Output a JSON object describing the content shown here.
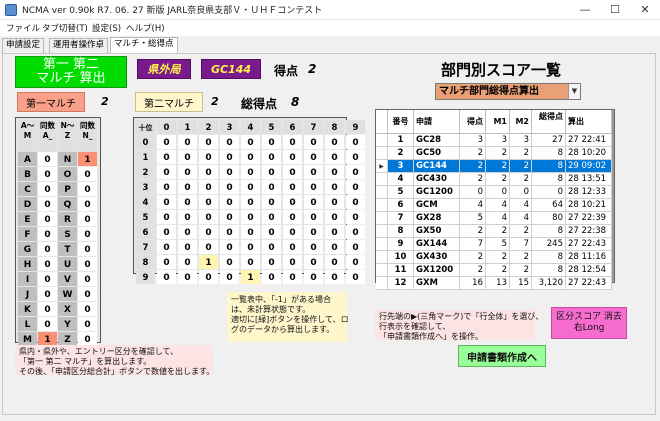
{
  "window": {
    "title": "NCMA ver 0.90k  R7. 06. 27 新版 JARL奈良県支部Ｖ・ＵＨＦコンテスト",
    "minimize": "—",
    "maximize": "☐",
    "close": "✕"
  },
  "menu": [
    "ファイル",
    "タブ切替(T)",
    "設定(S)",
    "ヘルプ(H)"
  ],
  "tabs": [
    "申請設定",
    "運用者操作卓",
    "マルチ・総得点"
  ],
  "calc_button": {
    "line1": "第一 第二",
    "line2": "マルチ 算出"
  },
  "tag_outside": "県外局",
  "tag_call": "GC144",
  "score_label": "得点",
  "score_value": "2",
  "first_multi": {
    "label": "第一マルチ",
    "value": "2"
  },
  "second_multi": {
    "label": "第二マルチ",
    "value": "2"
  },
  "total_label": "総得点",
  "total_value": "8",
  "left_grid": {
    "headers": [
      "A～M",
      "同数A_",
      "N～Z",
      "同数N_"
    ],
    "rows": [
      [
        "A",
        "0",
        "N",
        "1"
      ],
      [
        "B",
        "0",
        "O",
        "0"
      ],
      [
        "C",
        "0",
        "P",
        "0"
      ],
      [
        "D",
        "0",
        "Q",
        "0"
      ],
      [
        "E",
        "0",
        "R",
        "0"
      ],
      [
        "F",
        "0",
        "S",
        "0"
      ],
      [
        "G",
        "0",
        "T",
        "0"
      ],
      [
        "H",
        "0",
        "U",
        "0"
      ],
      [
        "I",
        "0",
        "V",
        "0"
      ],
      [
        "J",
        "0",
        "W",
        "0"
      ],
      [
        "K",
        "0",
        "X",
        "0"
      ],
      [
        "L",
        "0",
        "Y",
        "0"
      ],
      [
        "M",
        "1",
        "Z",
        "0"
      ]
    ]
  },
  "digit_grid": {
    "corner": "十位",
    "cols": [
      "0",
      "1",
      "2",
      "3",
      "4",
      "5",
      "6",
      "7",
      "8",
      "9"
    ],
    "rows": [
      [
        "0",
        "0",
        "0",
        "0",
        "0",
        "0",
        "0",
        "0",
        "0",
        "0"
      ],
      [
        "0",
        "0",
        "0",
        "0",
        "0",
        "0",
        "0",
        "0",
        "0",
        "0"
      ],
      [
        "0",
        "0",
        "0",
        "0",
        "0",
        "0",
        "0",
        "0",
        "0",
        "0"
      ],
      [
        "0",
        "0",
        "0",
        "0",
        "0",
        "0",
        "0",
        "0",
        "0",
        "0"
      ],
      [
        "0",
        "0",
        "0",
        "0",
        "0",
        "0",
        "0",
        "0",
        "0",
        "0"
      ],
      [
        "0",
        "0",
        "0",
        "0",
        "0",
        "0",
        "0",
        "0",
        "0",
        "0"
      ],
      [
        "0",
        "0",
        "0",
        "0",
        "0",
        "0",
        "0",
        "0",
        "0",
        "0"
      ],
      [
        "0",
        "0",
        "0",
        "0",
        "0",
        "0",
        "0",
        "0",
        "0",
        "0"
      ],
      [
        "0",
        "0",
        "1",
        "0",
        "0",
        "0",
        "0",
        "0",
        "0",
        "0"
      ],
      [
        "0",
        "0",
        "0",
        "0",
        "1",
        "0",
        "0",
        "0",
        "0",
        "0"
      ]
    ]
  },
  "note_yellow": "一覧表中、「-1」がある場合\nは、未計算状態です。\n適切に[緑]ボタンを操作して、ロ\nグのデータから算出します。",
  "note_left": "県内・県外や、エントリー区分を確認して、\n「第一 第二 マルチ」を算出します。\nその後、「申請区分総合計」ボタンで数値を出します。",
  "note_right": "行先端の▶(三角マーク)で「行全体」を選び、\n行表示を確認して、\n「申請書類作成へ」を操作。",
  "section_title": "部門別スコア一覧",
  "dropdown_value": "マルチ部門総得点算出",
  "table": {
    "headers": [
      "番号",
      "申請",
      "得点",
      "M1",
      "M2",
      "総得点",
      "算出"
    ],
    "rows": [
      [
        "1",
        "GC28",
        "3",
        "3",
        "3",
        "27",
        "27 22:41"
      ],
      [
        "2",
        "GC50",
        "2",
        "2",
        "2",
        "8",
        "28 10:20"
      ],
      [
        "3",
        "GC144",
        "2",
        "2",
        "2",
        "8",
        "29 09:02"
      ],
      [
        "4",
        "GC430",
        "2",
        "2",
        "2",
        "8",
        "28 13:51"
      ],
      [
        "5",
        "GC1200",
        "0",
        "0",
        "0",
        "0",
        "28 12:33"
      ],
      [
        "6",
        "GCM",
        "4",
        "4",
        "4",
        "64",
        "28 10:21"
      ],
      [
        "7",
        "GX28",
        "5",
        "4",
        "4",
        "80",
        "27 22:39"
      ],
      [
        "8",
        "GX50",
        "2",
        "2",
        "2",
        "8",
        "27 22:38"
      ],
      [
        "9",
        "GX144",
        "7",
        "5",
        "7",
        "245",
        "27 22:43"
      ],
      [
        "10",
        "GX430",
        "2",
        "2",
        "2",
        "8",
        "28 11:16"
      ],
      [
        "11",
        "GX1200",
        "2",
        "2",
        "2",
        "8",
        "28 12:54"
      ],
      [
        "12",
        "GXM",
        "16",
        "13",
        "15",
        "3,120",
        "27 22:43"
      ]
    ],
    "selected_row": 2
  },
  "clear_button": {
    "line1": "区分スコア 消去",
    "line2": "右Long"
  },
  "make_button": "申請書類作成へ",
  "colors": {
    "calc": "#00dc00",
    "tag": "#7b1a8d",
    "selection": "#0078d7",
    "clear": "#f76ccf",
    "make": "#99ff99"
  }
}
